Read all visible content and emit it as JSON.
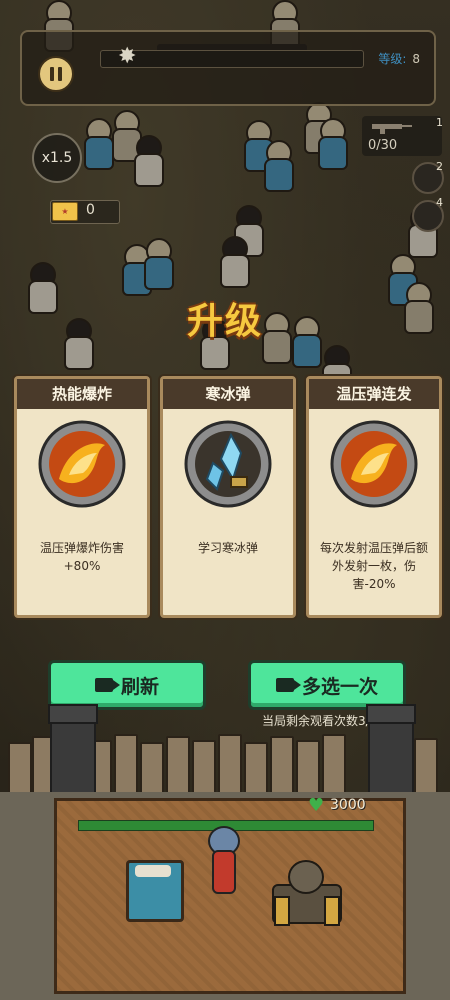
{
  "hud": {
    "level_label": "等级:",
    "level_value": "8",
    "speed": "x1.5",
    "tickets": "0",
    "ammo": "0/30",
    "weapon_slots": [
      "1",
      "2",
      "4"
    ]
  },
  "title": "升级",
  "cards": [
    {
      "title": "热能爆炸",
      "desc": "温压弹爆炸伤害+80%",
      "icon": "fireball-icon"
    },
    {
      "title": "寒冰弹",
      "desc": "学习寒冰弹",
      "icon": "ice-crystal-icon"
    },
    {
      "title": "温压弹连发",
      "desc": "每次发射温压弹后额外发射一枚，伤害-20%",
      "icon": "fireball-icon"
    }
  ],
  "buttons": {
    "refresh": "刷新",
    "pick_again": "多选一次",
    "views_left": "当局剩余观看次数3/3"
  },
  "base": {
    "hp": "3000"
  },
  "colors": {
    "title_gold": "#f6c940",
    "button_green": "#4ee59b",
    "hp_green": "#2e8a35",
    "card_bg": "#f0e4c6"
  }
}
